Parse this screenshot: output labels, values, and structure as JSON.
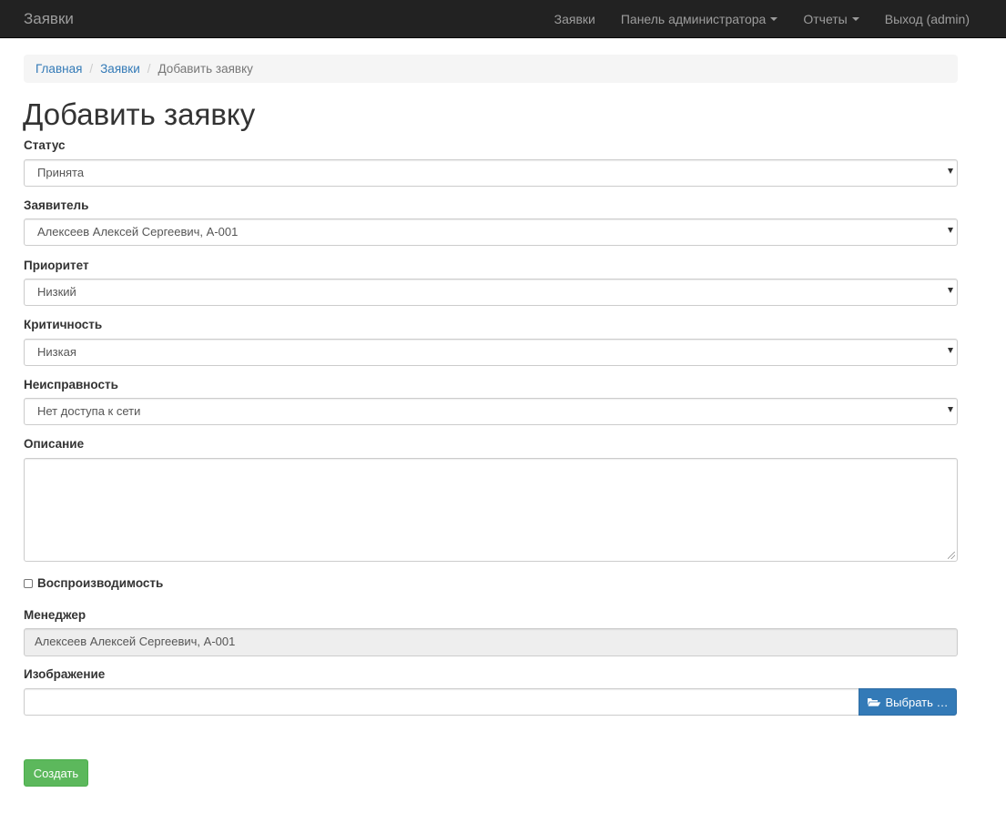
{
  "navbar": {
    "brand": "Заявки",
    "items": [
      {
        "label": "Заявки",
        "dropdown": false
      },
      {
        "label": "Панель администратора",
        "dropdown": true
      },
      {
        "label": "Отчеты",
        "dropdown": true
      },
      {
        "label": "Выход (admin)",
        "dropdown": false
      }
    ]
  },
  "breadcrumb": {
    "home": "Главная",
    "requests": "Заявки",
    "current": "Добавить заявку",
    "separator": "/"
  },
  "page": {
    "title": "Добавить заявку"
  },
  "form": {
    "status": {
      "label": "Статус",
      "value": "Принята"
    },
    "applicant": {
      "label": "Заявитель",
      "value": "Алексеев Алексей Сергеевич, А-001"
    },
    "priority": {
      "label": "Приоритет",
      "value": "Низкий"
    },
    "criticality": {
      "label": "Критичность",
      "value": "Низкая"
    },
    "malfunction": {
      "label": "Неисправность",
      "value": "Нет доступа к сети"
    },
    "description": {
      "label": "Описание",
      "value": ""
    },
    "reproducibility": {
      "label": "Воспроизводимость",
      "checked": false
    },
    "manager": {
      "label": "Менеджер",
      "value": "Алексеев Алексей Сергеевич, А-001"
    },
    "image": {
      "label": "Изображение",
      "browse_label": "Выбрать …"
    },
    "submit_label": "Создать"
  },
  "colors": {
    "navbar_bg": "#222222",
    "primary": "#337ab7",
    "success": "#5cb85c",
    "link": "#337ab7"
  }
}
